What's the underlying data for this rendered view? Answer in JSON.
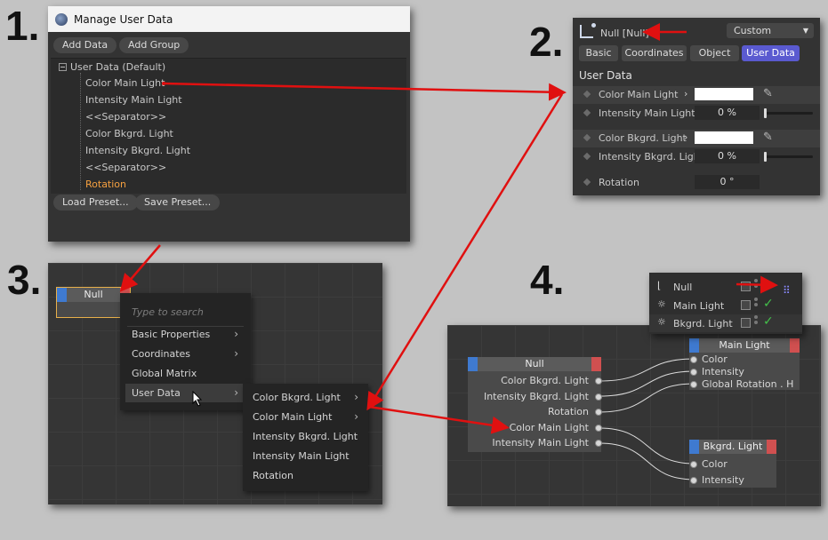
{
  "steps": {
    "one": "1.",
    "two": "2.",
    "three": "3.",
    "four": "4."
  },
  "colors": {
    "arrow": "#e01010",
    "accent": "#5a5ad0",
    "highlight_text": "#f5a040",
    "input_port": "#3f7ad0",
    "output_port": "#d05050"
  },
  "manage_user_data": {
    "title": "Manage User Data",
    "add_data": "Add Data",
    "add_group": "Add Group",
    "root": "User Data (Default)",
    "items": [
      {
        "label": "Color Main Light"
      },
      {
        "label": "Intensity Main Light"
      },
      {
        "label": "<<Separator>>"
      },
      {
        "label": "Color Bkgrd. Light"
      },
      {
        "label": "Intensity Bkgrd. Light"
      },
      {
        "label": "<<Separator>>"
      },
      {
        "label": "Rotation"
      }
    ],
    "load_preset": "Load Preset...",
    "save_preset": "Save Preset..."
  },
  "attributes": {
    "object_name": "Null [Null]",
    "mode": "Custom",
    "tabs": [
      "Basic",
      "Coordinates",
      "Object",
      "User Data"
    ],
    "section": "User Data",
    "rows": [
      {
        "label": "Color Main Light",
        "value": "",
        "color": "#ffffff"
      },
      {
        "label": "Intensity Main Light",
        "value": "0 %"
      },
      {
        "label": "Color Bkgrd. Light",
        "value": "",
        "color": "#ffffff"
      },
      {
        "label": "Intensity Bkgrd. Light",
        "value": "0 %"
      },
      {
        "label": "Rotation",
        "value": "0 °"
      }
    ],
    "intensity_main": 0,
    "intensity_bkgrd": 0
  },
  "node_editor_menu": {
    "node_title": "Null",
    "search_placeholder": "Type to search",
    "items": [
      "Basic Properties",
      "Coordinates",
      "Global Matrix",
      "User Data"
    ],
    "submenu": [
      "Color Bkgrd. Light",
      "Color Main Light",
      "Intensity Bkgrd. Light",
      "Intensity Main Light",
      "Rotation"
    ]
  },
  "object_manager": {
    "rows": [
      {
        "name": "Null",
        "icon": "null-icon"
      },
      {
        "name": "Main Light",
        "icon": "light-icon"
      },
      {
        "name": "Bkgrd. Light",
        "icon": "light-icon"
      }
    ]
  },
  "node_graph": {
    "null_node": {
      "title": "Null",
      "outputs": [
        "Color Bkgrd. Light",
        "Intensity Bkgrd. Light",
        "Rotation",
        "Color Main Light",
        "Intensity Main Light"
      ]
    },
    "main_light": {
      "title": "Main Light",
      "inputs": [
        "Color",
        "Intensity",
        "Global Rotation . H"
      ]
    },
    "bkgrd_light": {
      "title": "Bkgrd. Light",
      "inputs": [
        "Color",
        "Intensity"
      ]
    }
  }
}
